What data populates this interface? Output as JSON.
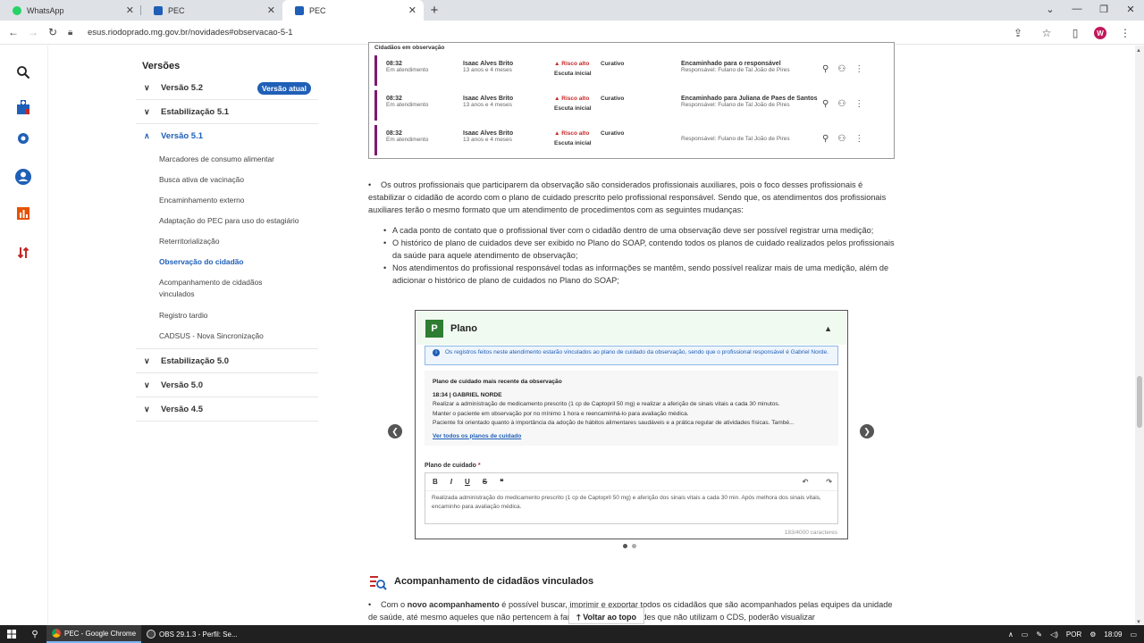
{
  "browser": {
    "tabs": [
      {
        "title": "WhatsApp",
        "color": "#25d366"
      },
      {
        "title": "PEC",
        "color": "#1f5fb7"
      },
      {
        "title": "PEC",
        "color": "#1f5fb7"
      }
    ],
    "url": "esus.riodoprado.mg.gov.br/novidades#observacao-5-1",
    "profile_initial": "W"
  },
  "versions": {
    "title": "Versões",
    "items": [
      {
        "label": "Versão 5.2",
        "badge": "Versão atual"
      },
      {
        "label": "Estabilização 5.1"
      },
      {
        "label": "Versão 5.1"
      },
      {
        "label": "Estabilização 5.0"
      },
      {
        "label": "Versão 5.0"
      },
      {
        "label": "Versão 4.5"
      }
    ],
    "subitems": [
      "Marcadores de consumo alimentar",
      "Busca ativa de vacinação",
      "Encaminhamento externo",
      "Adaptação do PEC para uso do estagiário",
      "Reterritorialização",
      "Observação do cidadão",
      "Acompanhamento de cidadãos vinculados",
      "Registro tardio",
      "CADSUS - Nova Sincronização"
    ]
  },
  "observation": {
    "header": "Cidadãos em observação",
    "rows": [
      {
        "time": "08:32",
        "status": "Em atendimento",
        "name": "Isaac Alves Brito",
        "age": "13 anos e 4 meses",
        "risk": "Risco alto",
        "escuta": "Escuta inicial",
        "type": "Curativo",
        "dest": "Encaminhado para o responsável",
        "resp": "Responsável: Fulano de Tal João de Pires"
      },
      {
        "time": "08:32",
        "status": "Em atendimento",
        "name": "Isaac Alves Brito",
        "age": "13 anos e 4 meses",
        "risk": "Risco alto",
        "escuta": "Escuta inicial",
        "type": "Curativo",
        "dest": "Encaminhado para Juliana de Paes de Santos",
        "resp": "Responsável: Fulano de Tal João de Pires"
      },
      {
        "time": "08:32",
        "status": "Em atendimento",
        "name": "Isaac Alves Brito",
        "age": "13 anos e 4 meses",
        "risk": "Risco alto",
        "escuta": "Escuta inicial",
        "type": "Curativo",
        "dest": "",
        "resp": "Responsável: Fulano de Tal João de Pires"
      }
    ]
  },
  "body": {
    "p1": "Os outros profissionais que participarem da observação são considerados profissionais auxiliares, pois o foco desses profissionais é estabilizar o cidadão de acordo com o plano de cuidado prescrito pelo profissional responsável. Sendo que, os atendimentos dos profissionais auxiliares terão o mesmo formato que um atendimento de procedimentos com as seguintes mudanças:",
    "b1": "A cada ponto de contato que o profissional tiver com o cidadão dentro de uma observação deve ser possível registrar uma medição;",
    "b2": "O histórico de plano de cuidados deve ser exibido no Plano do SOAP, contendo todos os planos de cuidado realizados pelos profissionais da saúde para aquele atendimento de observação;",
    "b3": "Nos atendimentos do profissional responsável todas as informações se mantêm, sendo possível realizar mais de uma medição, além de adicionar o histórico de plano de cuidados no Plano do SOAP;"
  },
  "plano": {
    "badge": "P",
    "title": "Plano",
    "info": "Os registros feitos neste atendimento estarão vinculados ao plano de cuidado da observação, sendo que o profissional responsável é Gabriel Norde.",
    "recent_title": "Plano de cuidado mais recente da observação",
    "recent_author": "18:34 | GABRIEL NORDE",
    "line1": "Realizar a administração de medicamento prescrito (1 cp de Captopril 50 mg) e realizar a aferição de sinais vitais a cada 30 minutos.",
    "line2": "Manter o paciente em observação por no mínimo 1 hora e reencaminhá-lo para avaliação médica.",
    "line3": "Paciente foi orientado quanto à importância da adoção de hábitos alimentares saudáveis e a prática regular de atividades físicas. També...",
    "link": "Ver todos os planos de cuidado",
    "field_label": "Plano de cuidado",
    "required": "*",
    "editor_text": "Realizada administração do medicamento prescrito (1 cp de Captopril 50 mg) e aferição dos sinais vitais a cada 30 min. Após melhora dos sinais vitais, encaminho para avaliação médica.",
    "counter": "183/4000 caracteres"
  },
  "section": {
    "title": "Acompanhamento de cidadãos vinculados",
    "p_start": "Com o ",
    "p_bold": "novo acompanhamento",
    "p_rest": " é possível buscar, imprimir e exportar todos os cidadãos que são acompanhados pelas equipes da unidade de saúde, até mesmo aqueles que não pertencem à familiar, ou seja, unidades que não utilizam o CDS, poderão visualizar"
  },
  "back_to_top": "Voltar ao topo",
  "taskbar": {
    "apps": [
      "PEC - Google Chrome",
      "OBS 29.1.3 - Perfil: Se..."
    ],
    "lang": "POR",
    "time": "18:09"
  }
}
